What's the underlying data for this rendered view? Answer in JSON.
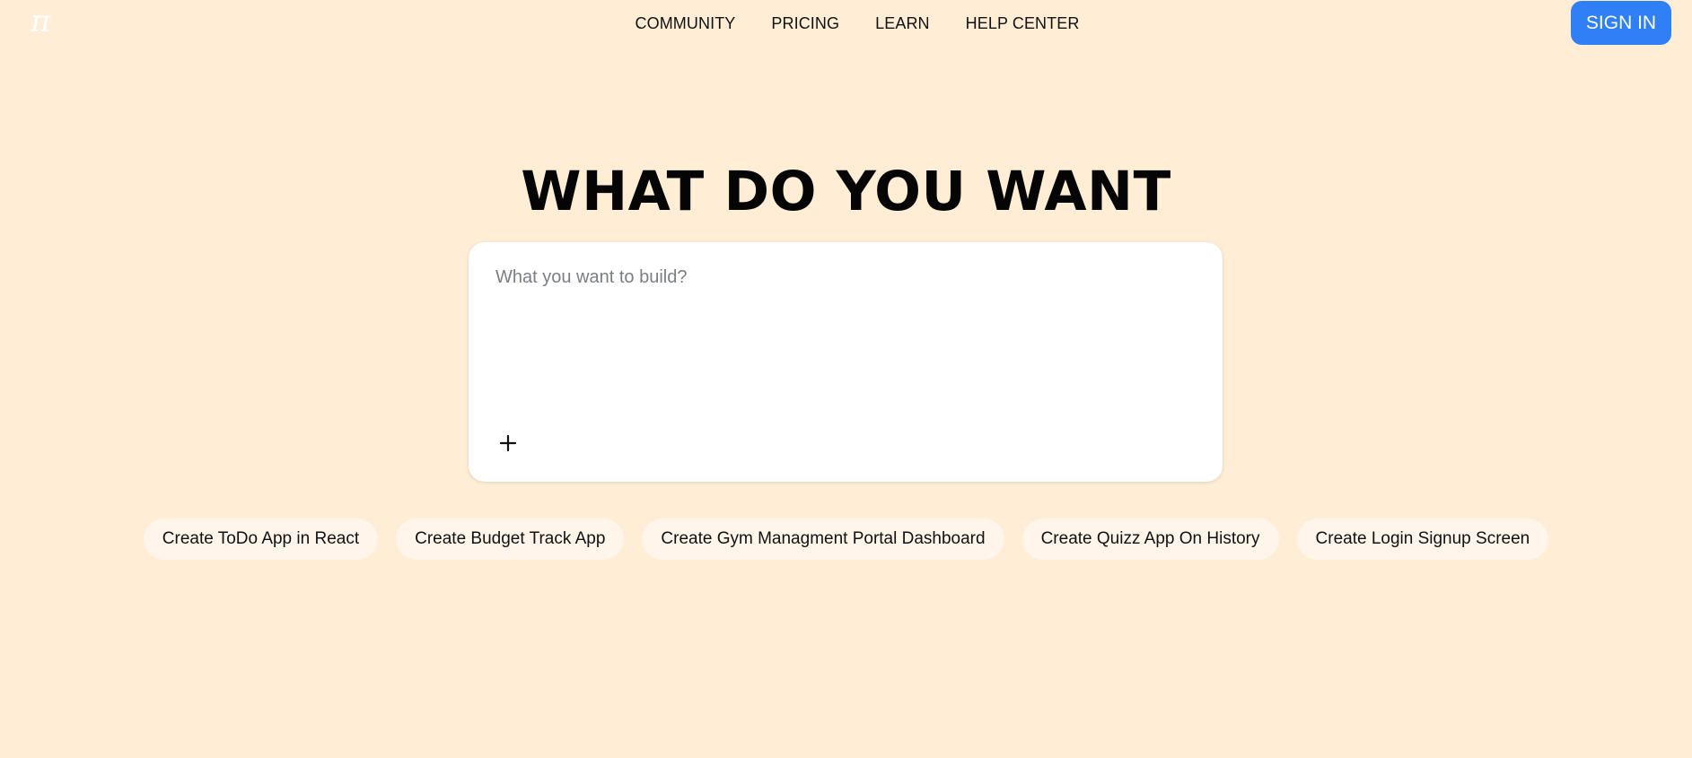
{
  "logo": {
    "glyph": "π",
    "icon": "pi-logo-icon"
  },
  "nav": {
    "items": [
      {
        "label": "COMMUNITY"
      },
      {
        "label": "PRICING"
      },
      {
        "label": "LEARN"
      },
      {
        "label": "HELP CENTER"
      }
    ]
  },
  "header": {
    "signin_label": "SIGN IN"
  },
  "hero": {
    "title": "WHAT DO YOU WANT"
  },
  "prompt": {
    "placeholder": "What you want to build?",
    "value": "",
    "add_icon": "plus-icon"
  },
  "suggestions": [
    {
      "label": "Create ToDo App in React"
    },
    {
      "label": "Create Budget Track App"
    },
    {
      "label": "Create Gym Managment Portal Dashboard"
    },
    {
      "label": "Create Quizz App On History"
    },
    {
      "label": "Create Login Signup Screen"
    }
  ],
  "colors": {
    "background": "#FFEDD5",
    "accent": "#2F80F6",
    "chip_background": "#FFF5EA",
    "card_background": "#FFFFFF"
  }
}
